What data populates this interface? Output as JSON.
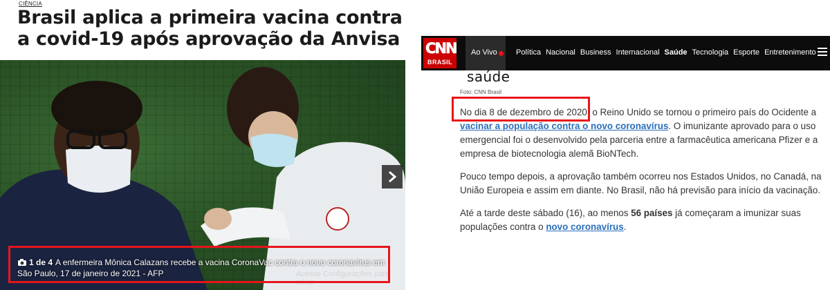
{
  "left_article": {
    "section": "CIÊNCIA",
    "headline": "Brasil aplica a primeira vacina contra a covid-19 após aprovação da Anvisa",
    "gallery_counter": "1 de 4",
    "caption": "A enfermeira Mônica Calazans recebe a vacina CoronaVac contra o novo coronavírus em São Paulo, 17 de janeiro de 2021 - AFP",
    "watermark": "Acesse Configurações para ativar",
    "icons": [
      "camera-icon",
      "chevron-right-icon"
    ]
  },
  "cnn": {
    "logo_text": "CNN",
    "logo_sub": "BRASIL",
    "live_label": "Ao Vivo",
    "nav": [
      "Política",
      "Nacional",
      "Business",
      "Internacional",
      "Saúde",
      "Tecnologia",
      "Esporte",
      "Entretenimento"
    ],
    "active_nav": "Saúde",
    "section_title": "saúde",
    "photo_credit": "Foto: CNN Brasil",
    "paragraphs": {
      "p1_a": "No dia 8 de dezembro de 2020,",
      "p1_b": " o Reino Unido se tornou o primeiro país do Ocidente a ",
      "p1_link": "vacinar a população contra o novo coronavírus",
      "p1_c": ". O imunizante aprovado para o uso emergencial foi o desenvolvido pela parceria entre a farmacêutica americana Pfizer e a empresa de biotecnologia alemã BioNTech.",
      "p2": "Pouco tempo depois, a aprovação também ocorreu nos Estados Unidos, no Canadá, na União Europeia e assim em diante. No Brasil, não há previsão para início da vacinação.",
      "p3_a": "Até a tarde deste sábado (16), ao menos ",
      "p3_bold": "56 países",
      "p3_b": " já começaram a imunizar suas populações contra o ",
      "p3_link": "novo coronavírus",
      "p3_c": "."
    }
  },
  "colors": {
    "highlight_box": "#e8141b",
    "cnn_red": "#cc0000",
    "link": "#2a6ebb",
    "nav_bg": "#0c0c0c"
  }
}
